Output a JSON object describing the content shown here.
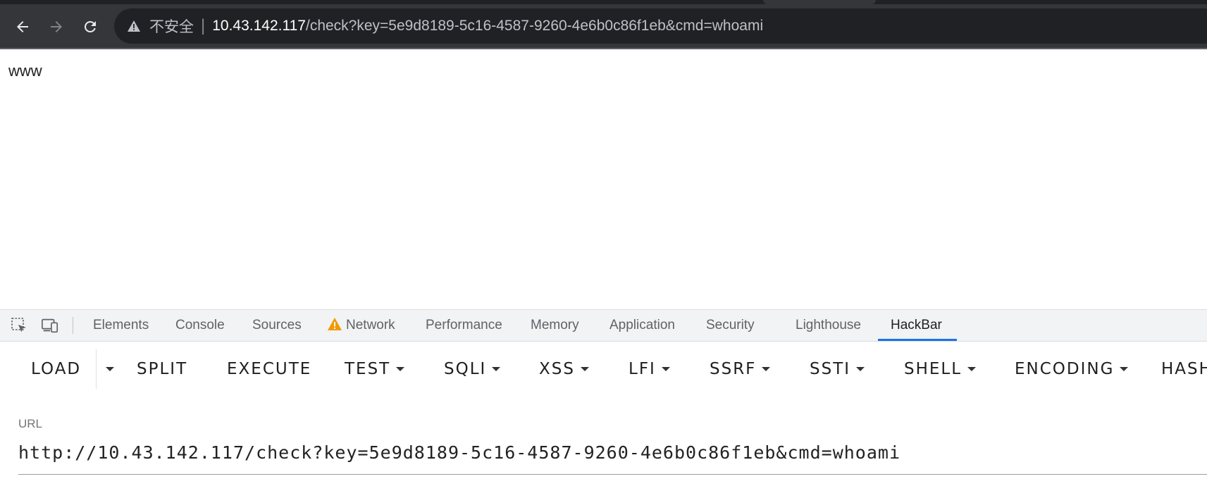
{
  "browser": {
    "security_label": "不安全",
    "separator": "|",
    "url_host": "10.43.142.117",
    "url_path": "/check?key=5e9d8189-5c16-4587-9260-4e6b0c86f1eb&cmd=whoami"
  },
  "page": {
    "text": "www"
  },
  "devtools": {
    "tabs": [
      "Elements",
      "Console",
      "Sources",
      "Network",
      "Performance",
      "Memory",
      "Application",
      "Security",
      "Lighthouse",
      "HackBar"
    ],
    "active_tab": "HackBar",
    "network_warning_icon": "warning-triangle-icon"
  },
  "hackbar": {
    "buttons": {
      "load": "LOAD",
      "split": "SPLIT",
      "execute": "EXECUTE",
      "test": "TEST",
      "sqli": "SQLI",
      "xss": "XSS",
      "lfi": "LFI",
      "ssrf": "SSRF",
      "ssti": "SSTI",
      "shell": "SHELL",
      "encoding": "ENCODING",
      "hash": "HASH"
    },
    "url_label": "URL",
    "url_value": "http://10.43.142.117/check?key=5e9d8189-5c16-4587-9260-4e6b0c86f1eb&cmd=whoami"
  },
  "colors": {
    "chrome_bg": "#35363a",
    "omnibox_bg": "#202124",
    "active_tab_underline": "#1a73e8",
    "warning": "#f29900"
  }
}
